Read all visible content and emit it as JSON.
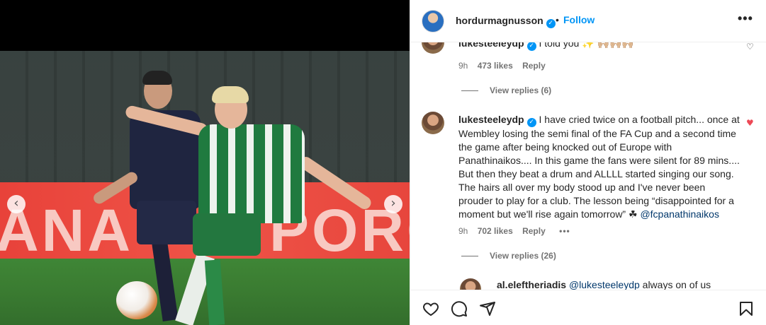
{
  "header": {
    "username": "hordurmagnusson",
    "separator": "•",
    "follow_label": "Follow",
    "more_label": "•••"
  },
  "media": {
    "board_text_left": "ANA",
    "board_text_right": "PORO",
    "prev_label": "‹",
    "next_label": "›"
  },
  "comments": [
    {
      "username": "lukesteeleydp",
      "text": "I told you ✨ 🙌🏼🙌🏼🙌🏼",
      "time": "9h",
      "likes": "473 likes",
      "reply_label": "Reply",
      "liked": false,
      "view_replies": "View replies (6)"
    },
    {
      "username": "lukesteeleydp",
      "text_lines": [
        "I have cried twice on a football pitch... once at",
        "Wembley losing the semi final of the FA Cup and a second time",
        "the game after being knocked out of Europe with",
        "Panathinaikos.... In this game the fans were silent for 89 mins....",
        "But then they beat a drum and ALLLL started singing our song.",
        "The hairs all over my body stood up and I've never been",
        "prouder to play for a club. The lesson being “disappointed for a",
        "moment but we'll rise again tomorrow” ☘"
      ],
      "mention": "@fcpanathinaikos",
      "time": "9h",
      "likes": "702 likes",
      "reply_label": "Reply",
      "options": "•••",
      "liked": true,
      "view_replies": "View replies (26)"
    },
    {
      "username": "al.eleftheriadis",
      "mention": "@lukesteeleydp",
      "text": "always on of us"
    }
  ],
  "colors": {
    "accent": "#0095f6",
    "liked_heart": "#ed4956",
    "text": "#262626",
    "muted": "#737373"
  },
  "icons": {
    "like": "heart-icon",
    "comment": "comment-icon",
    "share": "send-icon",
    "save": "bookmark-icon"
  }
}
